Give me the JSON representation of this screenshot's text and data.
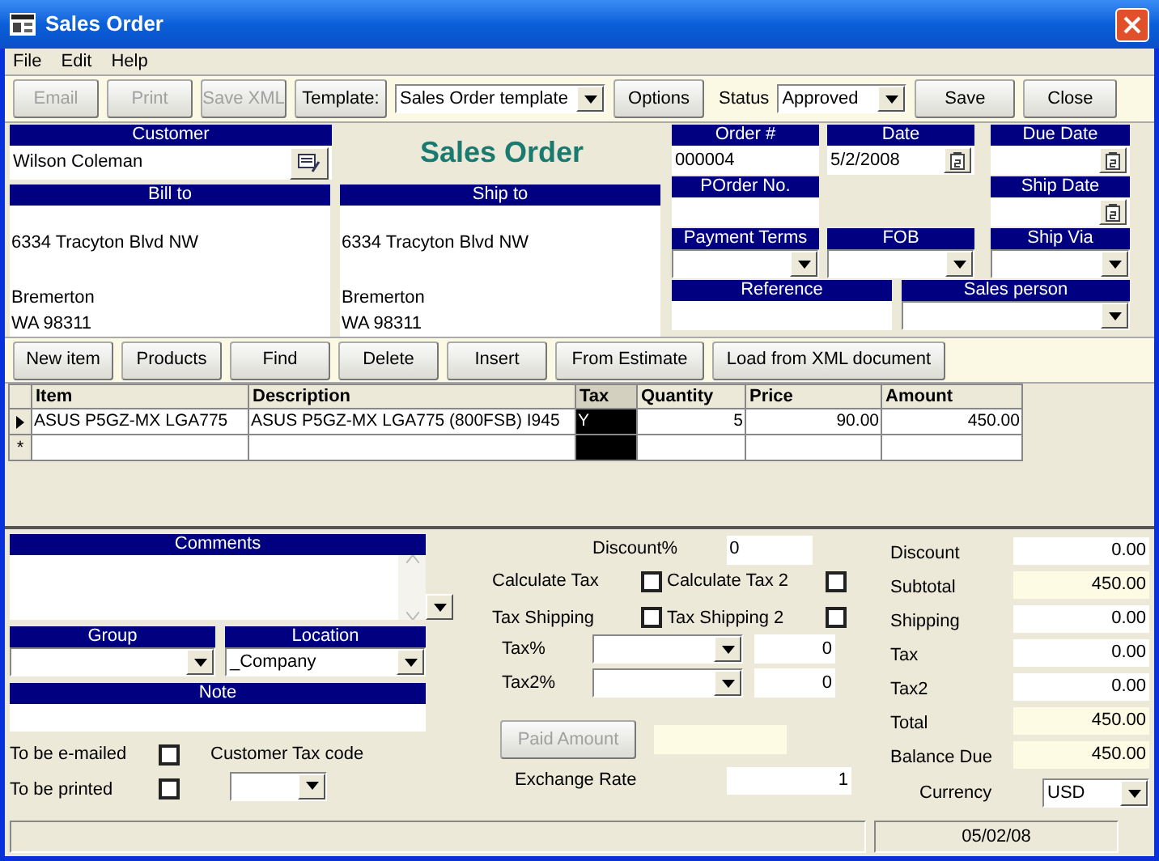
{
  "window": {
    "title": "Sales Order"
  },
  "menu": [
    "File",
    "Edit",
    "Help"
  ],
  "toolbar": {
    "buttons": [
      {
        "label": "Email",
        "disabled": true
      },
      {
        "label": "Print",
        "disabled": true
      },
      {
        "label": "Save XML",
        "disabled": true
      }
    ],
    "template_button": "Template:",
    "template": "Sales Order template",
    "options": "Options",
    "status_label": "Status",
    "status": "Approved",
    "save": "Save",
    "close": "Close"
  },
  "header": {
    "customer": {
      "label": "Customer",
      "value": "Wilson Coleman"
    },
    "title": "Sales Order",
    "bill_to": {
      "label": "Bill to",
      "lines": [
        "6334 Tracyton Blvd NW",
        "Bremerton",
        "WA  98311"
      ]
    },
    "ship_to": {
      "label": "Ship to",
      "lines": [
        "6334 Tracyton Blvd NW",
        "Bremerton",
        "WA  98311"
      ]
    },
    "order_no": {
      "label": "Order #",
      "value": "000004"
    },
    "date": {
      "label": "Date",
      "value": "5/2/2008"
    },
    "due_date": {
      "label": "Due Date"
    },
    "porder_no": {
      "label": "POrder No."
    },
    "ship_date": {
      "label": "Ship Date"
    },
    "payment_terms": {
      "label": "Payment Terms"
    },
    "fob": {
      "label": "FOB"
    },
    "ship_via": {
      "label": "Ship Via"
    },
    "reference": {
      "label": "Reference"
    },
    "sales_person": {
      "label": "Sales person"
    }
  },
  "item_actions": [
    "New item",
    "Products",
    "Find",
    "Delete",
    "Insert",
    "From Estimate",
    "Load from XML document"
  ],
  "table": {
    "columns": [
      {
        "label": "Item",
        "selected": false
      },
      {
        "label": "Description",
        "selected": false
      },
      {
        "label": "Tax",
        "selected": true
      },
      {
        "label": "Quantity",
        "selected": false
      },
      {
        "label": "Price",
        "selected": false
      },
      {
        "label": "Amount",
        "selected": false
      }
    ],
    "rows": [
      {
        "selected": true,
        "cells": [
          "ASUS P5GZ-MX LGA775",
          "ASUS P5GZ-MX LGA775 (800FSB) I945",
          "Y",
          "5",
          "90.00",
          "450.00"
        ]
      }
    ],
    "new_row_marker": "*"
  },
  "notes": {
    "comments": "Comments",
    "group": "Group",
    "location": {
      "label": "Location",
      "value": "_Company"
    },
    "note": "Note",
    "to_be_emailed": {
      "label": "To be e-mailed",
      "checked": false
    },
    "to_be_printed": {
      "label": "To be printed",
      "checked": false
    },
    "customer_tax_code": "Customer Tax code"
  },
  "tax": {
    "discount_pct": {
      "label": "Discount%",
      "value": "0"
    },
    "checks": [
      {
        "label": "Calculate Tax",
        "checked": false
      },
      {
        "label": "Calculate Tax 2",
        "checked": false
      },
      {
        "label": "Tax Shipping",
        "checked": false
      },
      {
        "label": "Tax Shipping 2",
        "checked": false
      }
    ],
    "tax_pct": {
      "label": "Tax%",
      "value": "0"
    },
    "tax2_pct": {
      "label": "Tax2%",
      "value": "0"
    },
    "paid_amount": {
      "label": "Paid Amount",
      "disabled": true
    },
    "exchange_rate": {
      "label": "Exchange Rate",
      "value": "1"
    }
  },
  "totals": [
    {
      "label": "Discount",
      "value": "0.00",
      "readonly": false
    },
    {
      "label": "Subtotal",
      "value": "450.00",
      "readonly": true
    },
    {
      "label": "Shipping",
      "value": "0.00",
      "readonly": false
    },
    {
      "label": "Tax",
      "value": "0.00",
      "readonly": false
    },
    {
      "label": "Tax2",
      "value": "0.00",
      "readonly": false
    },
    {
      "label": "Total",
      "value": "450.00",
      "readonly": true
    },
    {
      "label": "Balance Due",
      "value": "450.00",
      "readonly": true
    }
  ],
  "currency": {
    "label": "Currency",
    "value": "USD"
  },
  "status_bar": {
    "date": "05/02/08"
  }
}
